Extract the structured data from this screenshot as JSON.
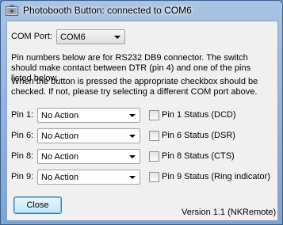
{
  "window": {
    "title": "Photobooth Button: connected to COM6"
  },
  "com_port": {
    "label": "COM Port:",
    "value": "COM6"
  },
  "info": {
    "paragraph1": "Pin numbers below are for RS232 DB9 connector. The switch should make contact between DTR (pin 4) and one of the pins listed below.",
    "paragraph2": "When the button is pressed the appropriate checkbox should be checked. If not, please try selecting a different COM port above."
  },
  "pins": [
    {
      "label": "Pin 1:",
      "action": "No Action",
      "status": "Pin 1 Status (DCD)"
    },
    {
      "label": "Pin 6:",
      "action": "No Action",
      "status": "Pin 6 Status (DSR)"
    },
    {
      "label": "Pin 8:",
      "action": "No Action",
      "status": "Pin 8 Status (CTS)"
    },
    {
      "label": "Pin 9:",
      "action": "No Action",
      "status": "Pin 9 Status (Ring indicator)"
    }
  ],
  "close_button": {
    "label": "Close"
  },
  "version": "Version 1.1 (NKRemote)"
}
